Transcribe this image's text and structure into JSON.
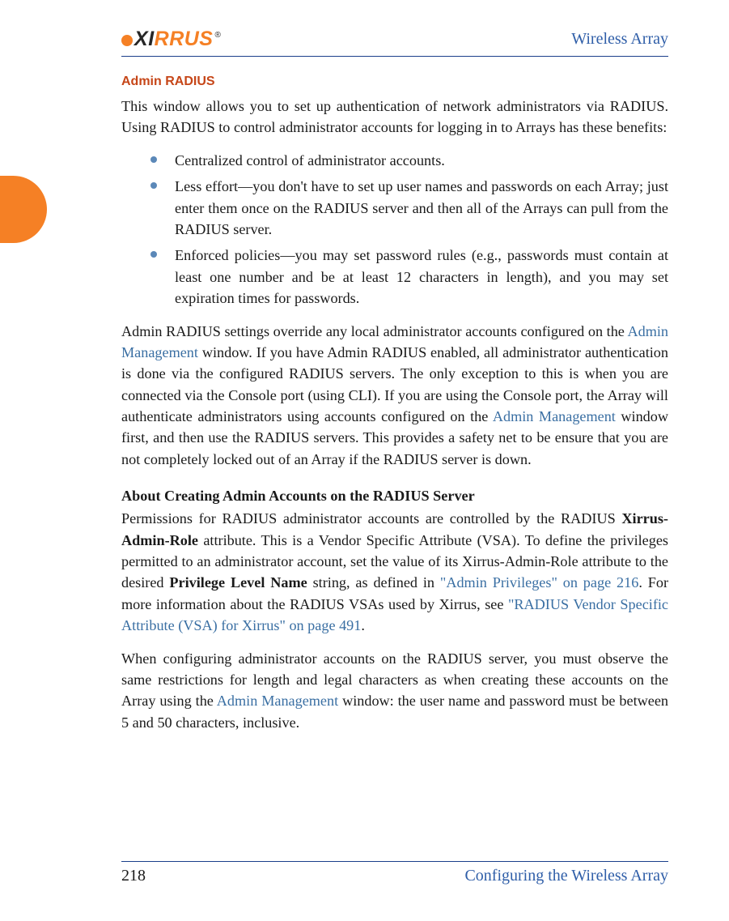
{
  "header": {
    "logo_text_1": "X",
    "logo_text_2": "I",
    "logo_text_3": "RRUS",
    "product": "Wireless Array"
  },
  "section_title": "Admin RADIUS",
  "intro": "This window allows you to set up authentication of network administrators via RADIUS. Using RADIUS to control administrator accounts for logging in to Arrays has these benefits:",
  "bullets": [
    "Centralized control of administrator accounts.",
    "Less effort—you don't have to set up user names and passwords on each Array; just enter them once on the RADIUS server and then all of the Arrays can pull from the RADIUS server.",
    "Enforced policies—you may set password rules (e.g., passwords must contain at least one number and be at least 12 characters in length), and you may set expiration times for passwords."
  ],
  "para2_parts": {
    "a": "Admin RADIUS settings override any local administrator accounts configured on the ",
    "link1": "Admin Management",
    "b": " window. If you have Admin RADIUS enabled, all administrator authentication is done via the configured RADIUS servers. The only exception to this is when you are connected via the Console port (using CLI). If you are using the Console port, the Array will authenticate administrators using accounts configured on the ",
    "link2": "Admin Management",
    "c": " window first, and then use the RADIUS servers. This provides a safety net to be ensure that you are not completely locked out of an Array if the RADIUS server is down."
  },
  "sub_heading": "About Creating Admin Accounts on the RADIUS Server",
  "para3_parts": {
    "a": "Permissions for RADIUS administrator accounts are controlled by the RADIUS ",
    "bold1": "Xirrus-Admin-Role",
    "b": " attribute. This is a Vendor Specific Attribute (VSA). To define the privileges permitted to an administrator account, set the value of its Xirrus-Admin-Role attribute to the desired ",
    "bold2": "Privilege Level Name",
    "c": " string, as defined in ",
    "qlink1": "\"Admin Privileges\" on page 216",
    "d": ". For more information about the RADIUS VSAs used by Xirrus, see ",
    "qlink2": "\"RADIUS Vendor Specific Attribute (VSA) for Xirrus\" on page 491",
    "e": "."
  },
  "para4_parts": {
    "a": "When configuring administrator accounts on the RADIUS server, you must observe the same restrictions for length and legal characters as when creating these accounts on the Array using the ",
    "link1": "Admin Management",
    "b": " window: the user name and password must be between 5 and 50 characters, inclusive."
  },
  "footer": {
    "page": "218",
    "section": "Configuring the Wireless Array"
  }
}
